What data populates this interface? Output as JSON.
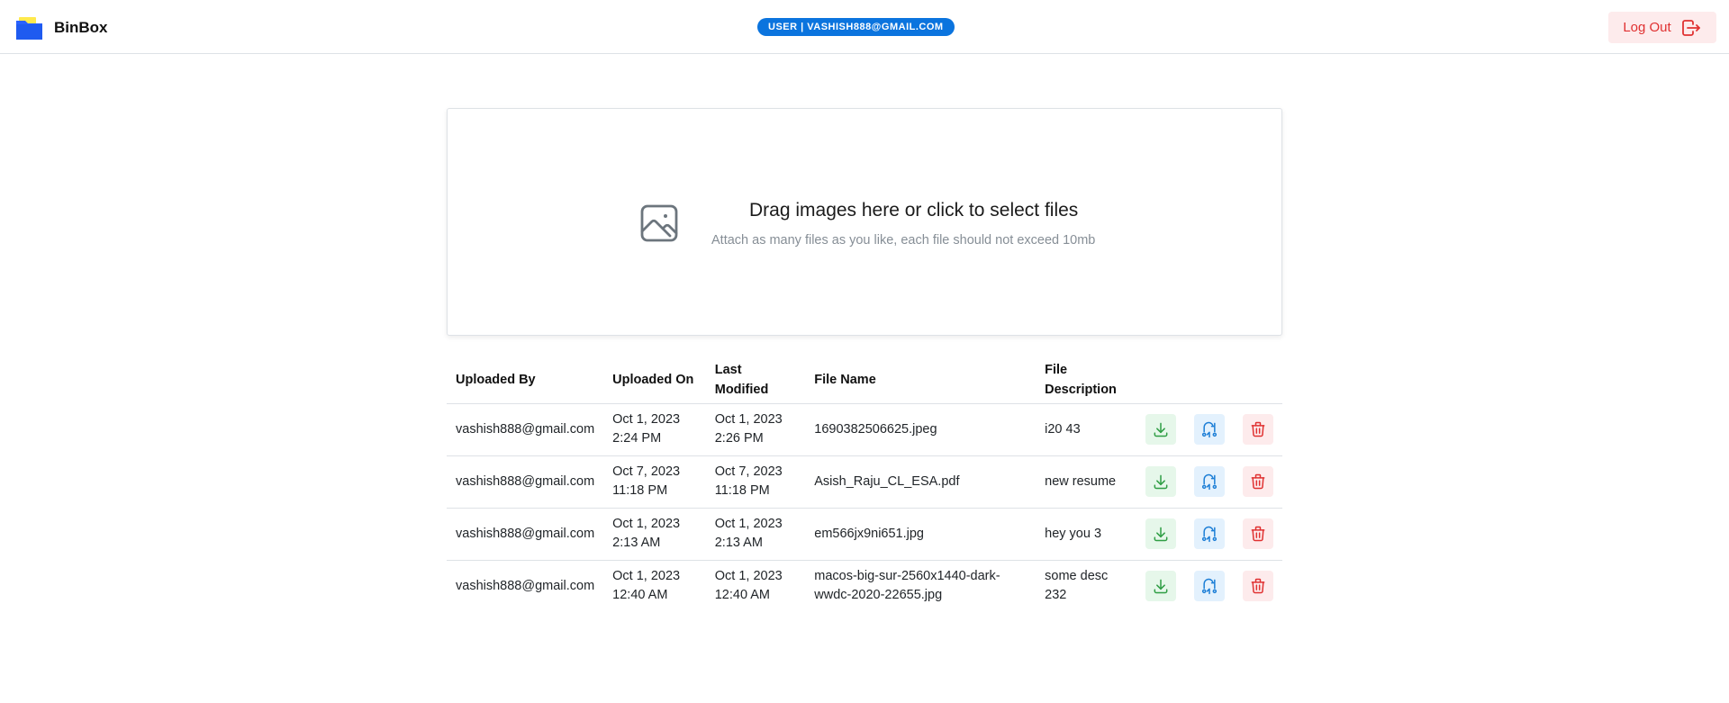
{
  "app": {
    "name": "BinBox"
  },
  "header": {
    "user_badge": "USER | VASHISH888@GMAIL.COM",
    "logout_label": "Log Out"
  },
  "dropzone": {
    "title": "Drag images here or click to select files",
    "subtitle": "Attach as many files as you like, each file should not exceed 10mb"
  },
  "table": {
    "columns": [
      "Uploaded By",
      "Uploaded On",
      "Last Modified",
      "File Name",
      "File Description"
    ],
    "rows": [
      {
        "uploaded_by": "vashish888@gmail.com",
        "uploaded_on_date": "Oct 1, 2023",
        "uploaded_on_time": "2:24 PM",
        "modified_date": "Oct 1, 2023",
        "modified_time": "2:26 PM",
        "file_name": "1690382506625.jpeg",
        "description": "i20 43"
      },
      {
        "uploaded_by": "vashish888@gmail.com",
        "uploaded_on_date": "Oct 7, 2023",
        "uploaded_on_time": "11:18 PM",
        "modified_date": "Oct 7, 2023",
        "modified_time": "11:18 PM",
        "file_name": "Asish_Raju_CL_ESA.pdf",
        "description": "new resume"
      },
      {
        "uploaded_by": "vashish888@gmail.com",
        "uploaded_on_date": "Oct 1, 2023",
        "uploaded_on_time": "2:13 AM",
        "modified_date": "Oct 1, 2023",
        "modified_time": "2:13 AM",
        "file_name": "em566jx9ni651.jpg",
        "description": "hey you 3"
      },
      {
        "uploaded_by": "vashish888@gmail.com",
        "uploaded_on_date": "Oct 1, 2023",
        "uploaded_on_time": "12:40 AM",
        "modified_date": "Oct 1, 2023",
        "modified_time": "12:40 AM",
        "file_name": "macos-big-sur-2560x1440-dark-wwdc-2020-22655.jpg",
        "description": "some desc 232"
      }
    ],
    "actions": {
      "download_icon": "download-icon",
      "replace_icon": "replace-icon",
      "delete_icon": "trash-icon"
    }
  },
  "colors": {
    "accent": "#0b74de",
    "danger": "#e03131",
    "success": "#2f9e44",
    "info": "#1c7ed6"
  }
}
